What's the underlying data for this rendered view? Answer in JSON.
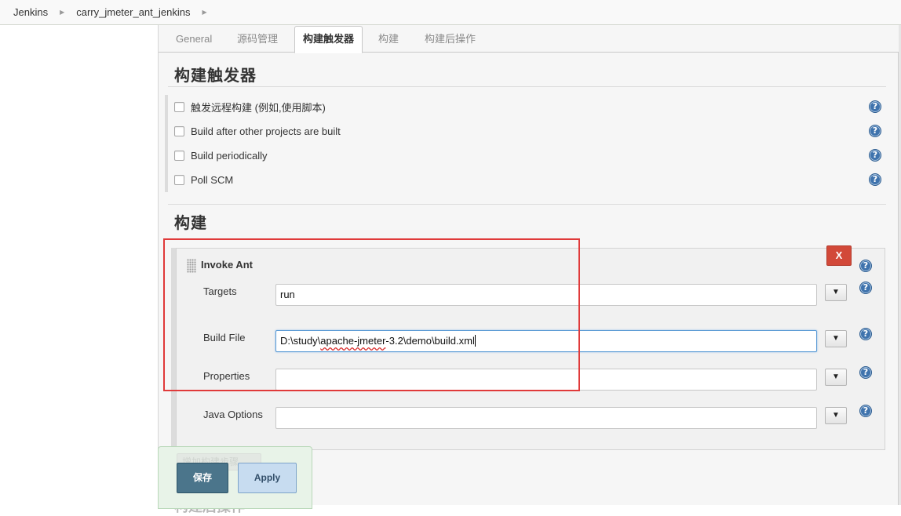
{
  "breadcrumb": {
    "items": [
      "Jenkins",
      "carry_jmeter_ant_jenkins"
    ]
  },
  "tabs": [
    {
      "label": "General",
      "active": false
    },
    {
      "label": "源码管理",
      "active": false
    },
    {
      "label": "构建触发器",
      "active": true
    },
    {
      "label": "构建",
      "active": false
    },
    {
      "label": "构建后操作",
      "active": false
    }
  ],
  "triggers": {
    "title": "构建触发器",
    "options": [
      {
        "label": "触发远程构建 (例如,使用脚本)",
        "checked": false
      },
      {
        "label": "Build after other projects are built",
        "checked": false
      },
      {
        "label": "Build periodically",
        "checked": false
      },
      {
        "label": "Poll SCM",
        "checked": false
      }
    ]
  },
  "build": {
    "title": "构建",
    "step": {
      "title": "Invoke Ant",
      "delete_label": "X",
      "fields": {
        "targets": {
          "label": "Targets",
          "value": "run"
        },
        "build_file": {
          "label": "Build File",
          "value_prefix": "D:\\study\\",
          "value_underlined": "apache-jmeter",
          "value_suffix": "-3.2\\demo\\build.xml"
        },
        "properties": {
          "label": "Properties",
          "value": ""
        },
        "java_options": {
          "label": "Java Options",
          "value": ""
        }
      }
    },
    "add_step_label": "增加构建步骤"
  },
  "post_build_title": "构建后操作",
  "actions": {
    "save": "保存",
    "apply": "Apply"
  },
  "help_glyph": "?",
  "expand_glyph": "▼",
  "colors": {
    "delete": "#d24939",
    "save": "#4b758b",
    "apply": "#c7dcf0",
    "highlight": "#e03a3a",
    "help": "#3f73ad"
  }
}
